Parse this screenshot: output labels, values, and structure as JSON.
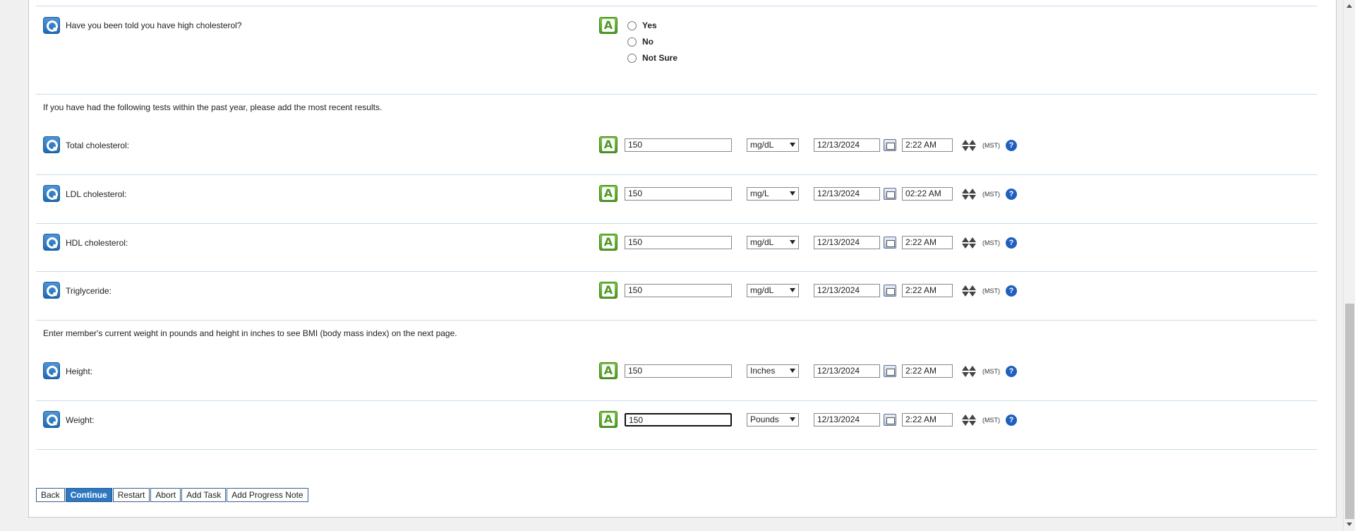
{
  "cholesterol_question": {
    "label": "Have you been told you have high cholesterol?",
    "options": [
      "Yes",
      "No",
      "Not Sure"
    ]
  },
  "tests_note": "If you have had the following tests within the past year, please add the most recent results.",
  "bmi_note": "Enter member's current weight in pounds and height in inches to see BMI (body mass index) on the next page.",
  "rows": [
    {
      "label": "Total cholesterol:",
      "value": "150",
      "unit": "mg/dL",
      "date": "12/13/2024",
      "time": "2:22 AM",
      "tz": "(MST)"
    },
    {
      "label": "LDL cholesterol:",
      "value": "150",
      "unit": "mg/L",
      "date": "12/13/2024",
      "time": "02:22 AM",
      "tz": "(MST)"
    },
    {
      "label": "HDL cholesterol:",
      "value": "150",
      "unit": "mg/dL",
      "date": "12/13/2024",
      "time": "2:22 AM",
      "tz": "(MST)"
    },
    {
      "label": "Triglyceride:",
      "value": "150",
      "unit": "mg/dL",
      "date": "12/13/2024",
      "time": "2:22 AM",
      "tz": "(MST)"
    },
    {
      "label": "Height:",
      "value": "150",
      "unit": "Inches",
      "date": "12/13/2024",
      "time": "2:22 AM",
      "tz": "(MST)"
    },
    {
      "label": "Weight:",
      "value": "150",
      "unit": "Pounds",
      "date": "12/13/2024",
      "time": "2:22 AM",
      "tz": "(MST)"
    }
  ],
  "answer_glyph": "A",
  "help_glyph": "?",
  "buttons": {
    "back": "Back",
    "continue": "Continue",
    "restart": "Restart",
    "abort": "Abort",
    "add_task": "Add Task",
    "add_progress_note": "Add Progress Note"
  },
  "colors": {
    "question_icon": "#1f6ab4",
    "answer_icon": "#4e9a24",
    "primary_button": "#2f78c0",
    "help_icon": "#1f5fbf"
  }
}
